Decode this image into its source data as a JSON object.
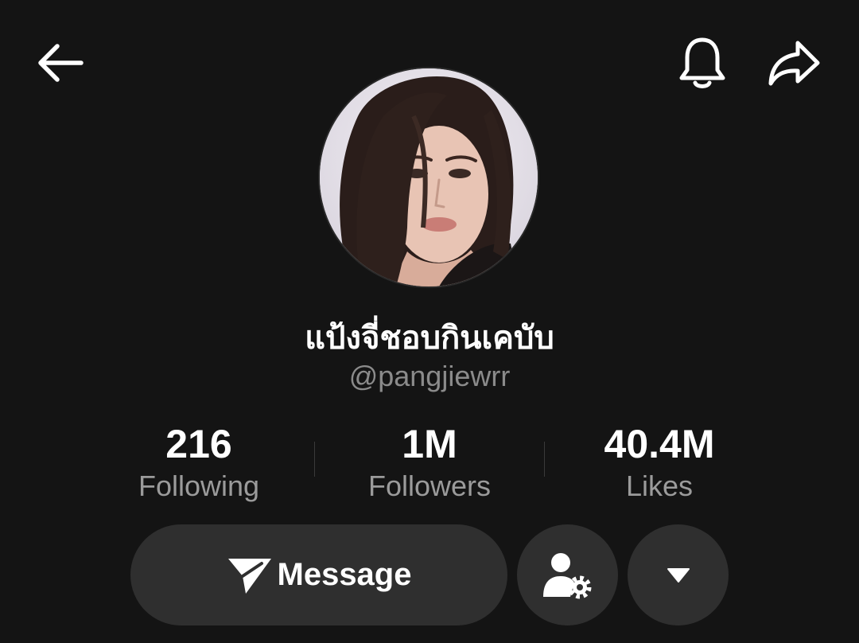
{
  "profile": {
    "display_name": "แป้งจี่ชอบกินเคบับ",
    "handle": "@pangjiewrr"
  },
  "stats": [
    {
      "value": "216",
      "label": "Following"
    },
    {
      "value": "1M",
      "label": "Followers"
    },
    {
      "value": "40.4M",
      "label": "Likes"
    }
  ],
  "actions": {
    "message_label": "Message"
  },
  "icons": {
    "back": "arrow-left-icon",
    "notifications": "bell-icon",
    "share": "share-arrow-icon",
    "message": "paper-plane-icon",
    "user_settings": "user-gear-icon",
    "more": "triangle-down-icon"
  },
  "colors": {
    "background": "#141414",
    "button": "#2f2f2f",
    "secondary_text": "#9b9b9b"
  }
}
